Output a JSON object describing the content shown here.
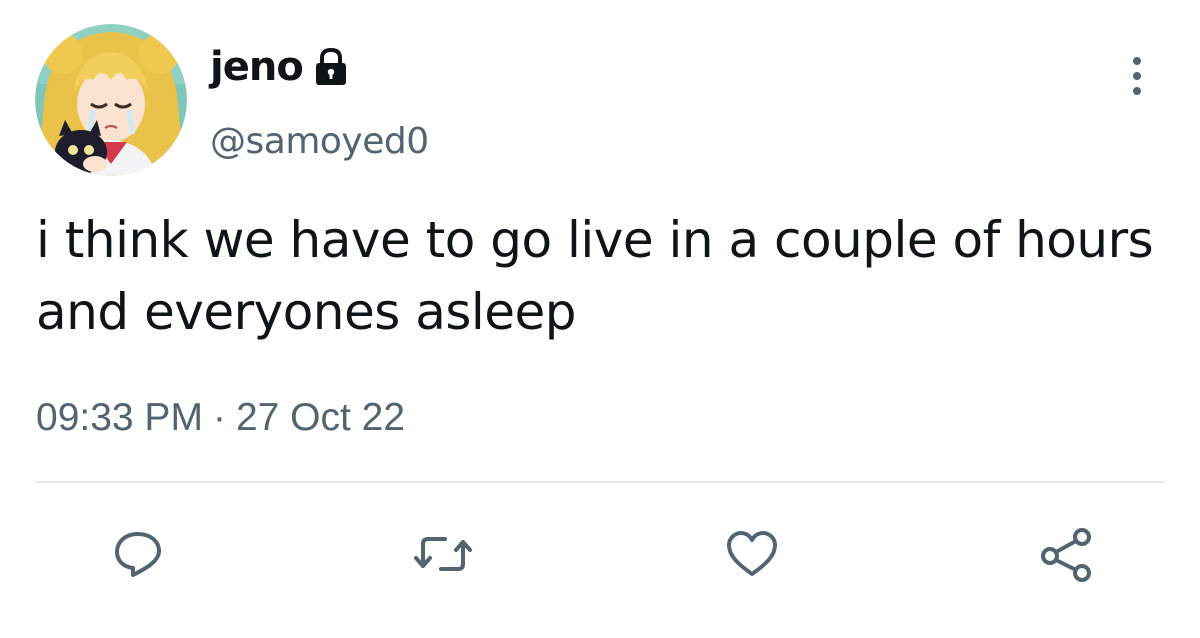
{
  "tweet": {
    "author": {
      "display_name": "jeno",
      "handle": "@samoyed0",
      "protected_icon": "lock-icon",
      "avatar": "avatar"
    },
    "text": "i think we have to go live in a couple of hours and everyones asleep",
    "time": "09:33 PM",
    "separator": "·",
    "date": "27 Oct 22"
  },
  "actions": [
    {
      "name": "reply",
      "icon": "reply-icon"
    },
    {
      "name": "retweet",
      "icon": "retweet-icon"
    },
    {
      "name": "like",
      "icon": "heart-icon"
    },
    {
      "name": "share",
      "icon": "share-icon"
    }
  ],
  "menu": {
    "icon": "more-vertical-icon"
  },
  "colors": {
    "text_primary": "#0f1419",
    "text_secondary": "#536471",
    "icon": "#536471",
    "divider": "#e6e8ea",
    "background": "#ffffff"
  }
}
